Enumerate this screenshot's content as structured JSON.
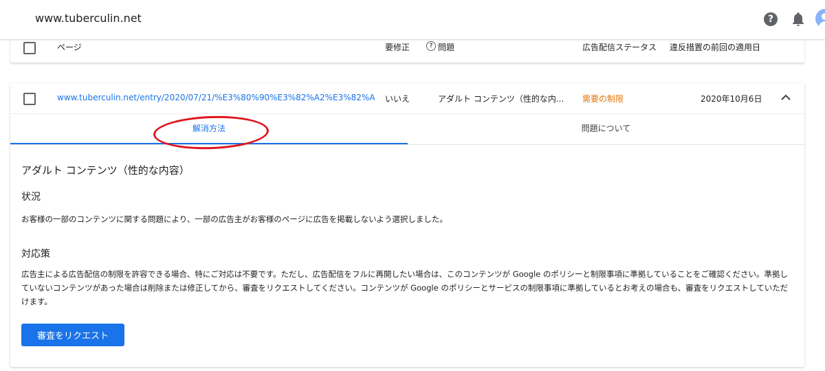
{
  "topbar": {
    "site": "www.tuberculin.net",
    "help_icon": "help-circle-icon",
    "bell_icon": "bell-icon",
    "avatar_icon": "avatar-icon"
  },
  "table_header": {
    "page": "ページ",
    "needs_fix": "要修正",
    "issue": "問題",
    "ad_status": "広告配信ステータス",
    "last_enforced": "違反措置の前回の適用日"
  },
  "row": {
    "url": "www.tuberculin.net/entry/2020/07/21/%E3%80%90%E3%82%A2%E3%82%A6...",
    "needs_fix": "いいえ",
    "issue": "アダルト コンテンツ（性的な内...",
    "status": "需要の制限",
    "date": "2020年10月6日"
  },
  "tabs": {
    "solution": "解消方法",
    "about": "問題について"
  },
  "detail": {
    "issue_title": "アダルト コンテンツ（性的な内容）",
    "situation_title": "状況",
    "situation_text": "お客様の一部のコンテンツに関する問題により、一部の広告主がお客様のページに広告を掲載しないよう選択しました。",
    "action_title": "対応策",
    "action_text": "広告主による広告配信の制限を許容できる場合、特にご対応は不要です。ただし、広告配信をフルに再開したい場合は、このコンテンツが Google のポリシーと制限事項に準拠していることをご確認ください。準拠していないコンテンツがあった場合は削除または修正してから、審査をリクエストしてください。コンテンツが Google のポリシーとサービスの制限事項に準拠しているとお考えの場合も、審査をリクエストしていただけます。",
    "request_button": "審査をリクエスト"
  },
  "colors": {
    "accent": "#1a73e8",
    "status": "#e37400",
    "annotation": "#e0141e"
  }
}
